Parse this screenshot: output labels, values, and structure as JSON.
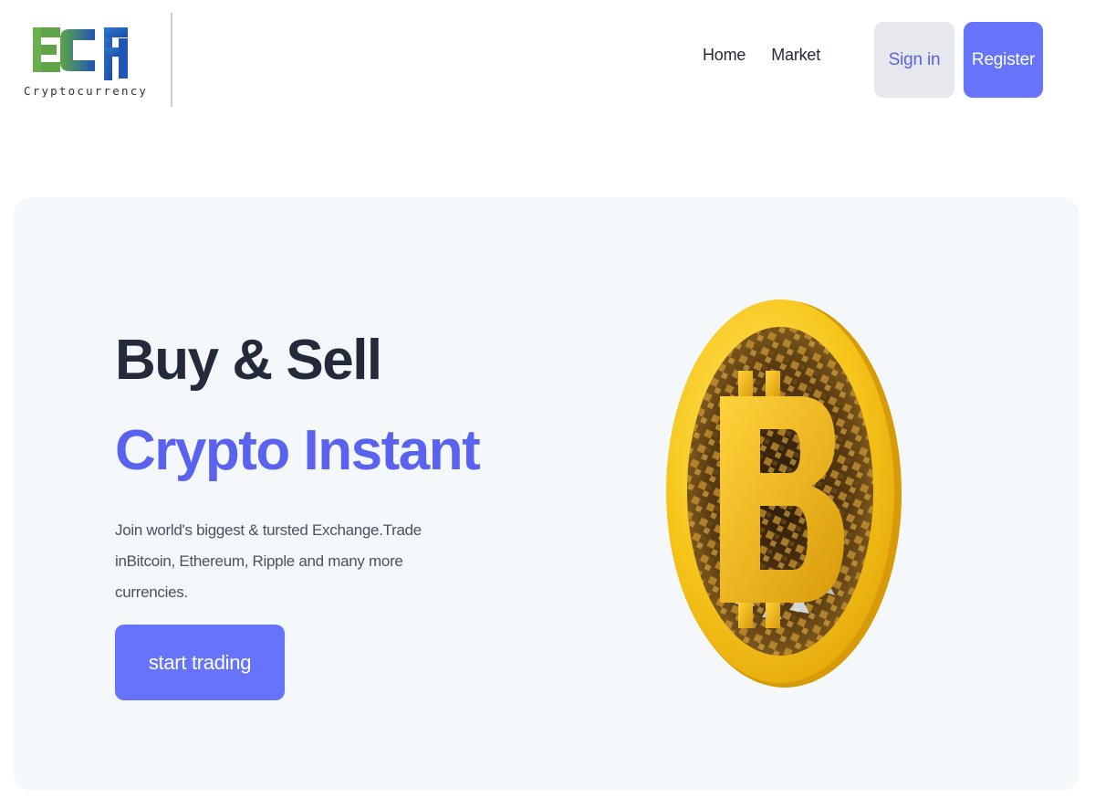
{
  "brand": {
    "logo_letters": "ECF",
    "logo_text": "Cryptocurrency"
  },
  "nav": {
    "items": [
      {
        "label": "Home"
      },
      {
        "label": "Market"
      }
    ]
  },
  "auth": {
    "signin_label": "Sign in",
    "register_label": "Register"
  },
  "hero": {
    "title_line1": "Buy & Sell",
    "title_line2": "Crypto Instant",
    "description": "Join world's biggest & tursted Exchange.Trade inBitcoin, Ethereum, Ripple and many more currencies.",
    "cta_label": "start trading",
    "coin_icon": "bitcoin-coin-icon"
  },
  "colors": {
    "accent": "#6574fa",
    "accent_text": "#5a63f0",
    "heading": "#232a3a",
    "hero_bg": "#f4f8fa",
    "signin_bg": "#e7e8ee",
    "logo_green": "#5fa547",
    "logo_blue": "#1f55b6",
    "coin_gold": "#f5c518"
  }
}
